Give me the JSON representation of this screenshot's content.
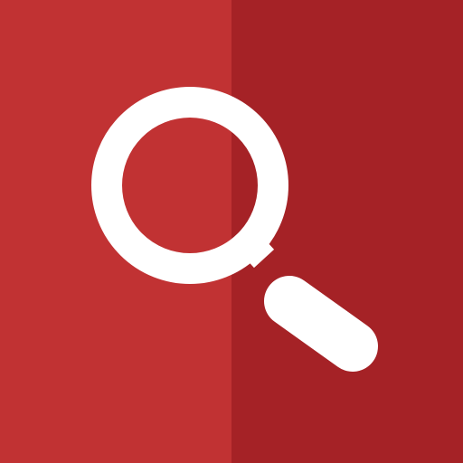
{
  "icon": {
    "name": "search-icon",
    "colors": {
      "background_left": "#c13233",
      "background_right": "#a52226",
      "glyph": "#ffffff"
    }
  }
}
